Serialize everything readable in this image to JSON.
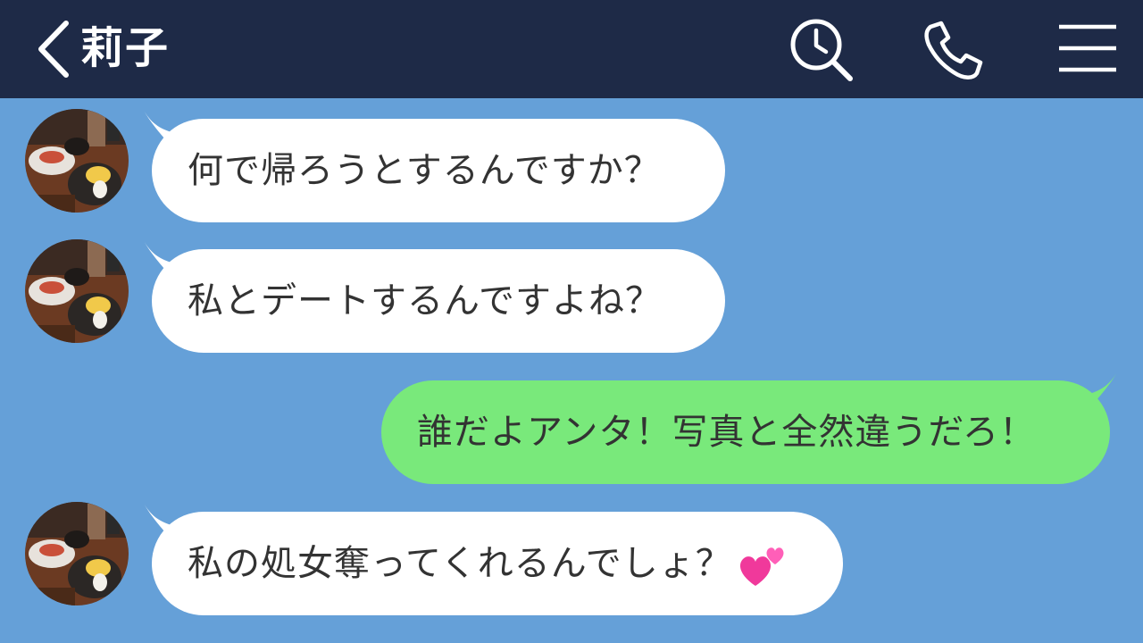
{
  "header": {
    "title": "莉子",
    "back_icon": "chevron-left-icon",
    "search_icon": "search-history-icon",
    "call_icon": "phone-icon",
    "menu_icon": "hamburger-menu-icon",
    "background": "#1e2a47"
  },
  "chat": {
    "background": "#65a0d8",
    "incoming_bubble_color": "#ffffff",
    "outgoing_bubble_color": "#79e97b",
    "messages": [
      {
        "sender": "莉子",
        "direction": "incoming",
        "text": "何で帰ろうとするんですか？"
      },
      {
        "sender": "莉子",
        "direction": "incoming",
        "text": "私とデートするんですよね？"
      },
      {
        "sender": "me",
        "direction": "outgoing",
        "text": "誰だよアンタ！写真と全然違うだろ！"
      },
      {
        "sender": "莉子",
        "direction": "incoming",
        "text": "私の処女奪ってくれるんでしょ？",
        "emoji": "two-hearts-icon"
      }
    ]
  }
}
